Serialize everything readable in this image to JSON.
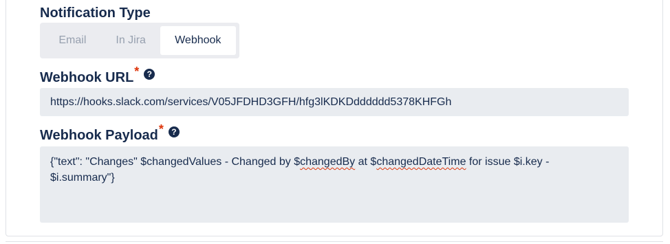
{
  "notification_type": {
    "label": "Notification Type",
    "options": [
      "Email",
      "In Jira",
      "Webhook"
    ],
    "selected": "Webhook"
  },
  "webhook_url": {
    "label": "Webhook URL",
    "required_mark": "*",
    "help_icon": "question-circle-icon",
    "help_glyph": "?",
    "value": "https://hooks.slack.com/services/V05JFDHD3GFH/hfg3lKDKDdddddd5378KHFGh"
  },
  "webhook_payload": {
    "label": "Webhook Payload",
    "required_mark": "*",
    "help_icon": "question-circle-icon",
    "help_glyph": "?",
    "value_parts": [
      "{\"text\": \"Changes\" $changedValues - Changed by $",
      "changedBy",
      " at $",
      "changedDateTime",
      " for issue $i.key -\n$i.summary\"}"
    ]
  },
  "colors": {
    "text": "#172b4d",
    "required": "#de350b",
    "input_bg": "#e9ecf0",
    "segment_bg": "#ebecf0",
    "segment_inactive_text": "#97a0af"
  }
}
